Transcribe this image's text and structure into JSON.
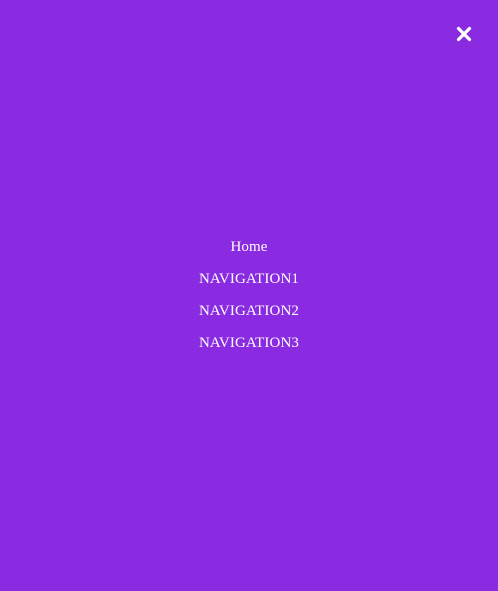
{
  "overlay": {
    "background_color": "#8a2be2",
    "text_color": "#ffffff"
  },
  "close_button": {
    "icon": "close-icon"
  },
  "nav": {
    "items": [
      {
        "label": "Home"
      },
      {
        "label": "NAVIGATION1"
      },
      {
        "label": "NAVIGATION2"
      },
      {
        "label": "NAVIGATION3"
      }
    ]
  }
}
